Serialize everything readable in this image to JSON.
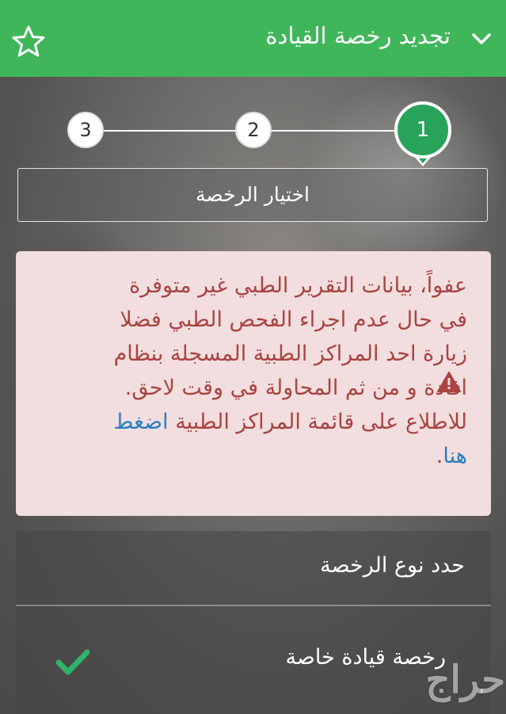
{
  "header": {
    "title": "تجديد رخصة القيادة",
    "background": "#40b65a",
    "icons": [
      "star-outline-icon",
      "chevron-down-icon"
    ]
  },
  "stepper": {
    "steps": [
      "1",
      "2",
      "3"
    ],
    "active_step": "1",
    "active_color": "#27a35a"
  },
  "licence_box": {
    "label": "اختيار الرخصة"
  },
  "alert": {
    "text": "عفواً، بيانات التقرير الطبي غير متوفرة في حال عدم اجراء الفحص الطبي فضلا زيارة احد المراكز الطبية المسجلة بنظام افادة و من ثم المحاولة في وقت لاحق. للاطلاع على قائمة المراكز الطبية",
    "link_text": "اضغط هنا",
    "end_punct": ".",
    "icon": "warning-triangle-icon",
    "background": "#f2dede",
    "text_color": "#a94442",
    "link_color": "#2a7fc2"
  },
  "licence_type": {
    "title": "حدد نوع الرخصة",
    "options": [
      {
        "label": "رخصة قيادة خاصة",
        "selected": true
      }
    ]
  },
  "watermark": {
    "text": "حراج"
  }
}
